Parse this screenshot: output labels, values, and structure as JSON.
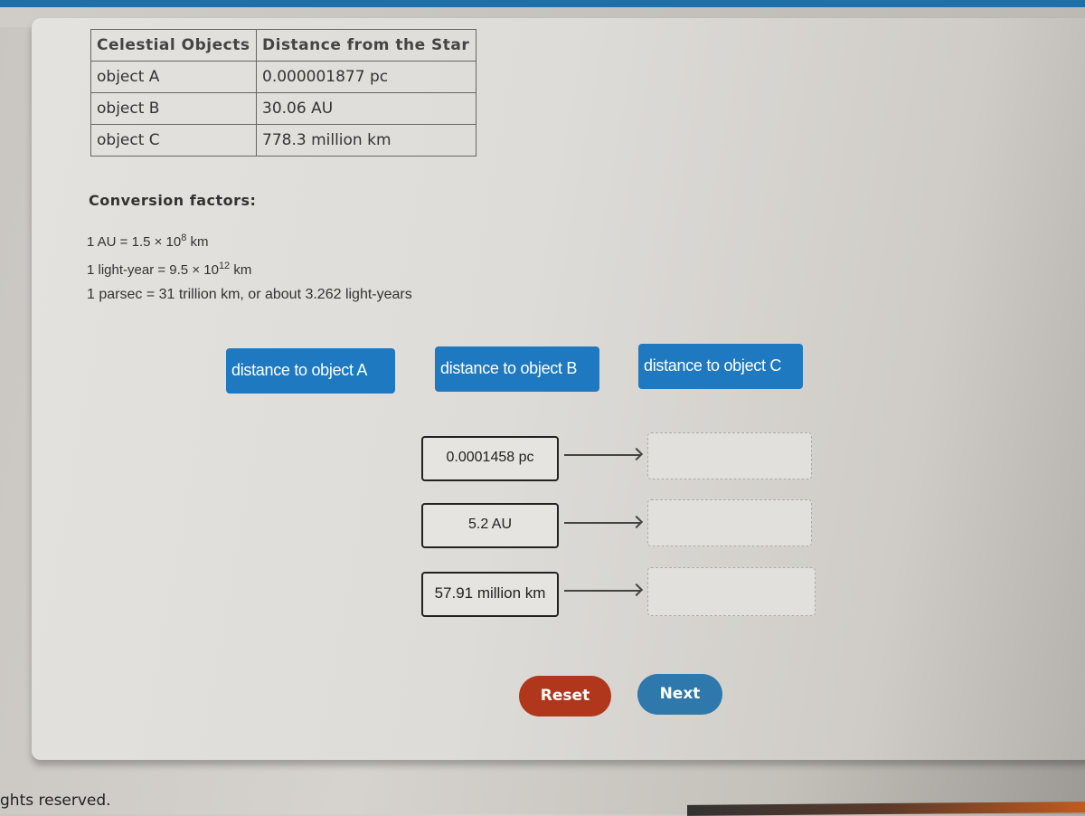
{
  "table": {
    "headers": [
      "Celestial Objects",
      "Distance from the Star"
    ],
    "rows": [
      [
        "object A",
        "0.000001877 pc"
      ],
      [
        "object B",
        "30.06 AU"
      ],
      [
        "object C",
        "778.3 million km"
      ]
    ]
  },
  "conversion": {
    "title": "Conversion factors:",
    "au": {
      "pre": "1 AU = 1.5 × 10",
      "exp": "8",
      "post": " km"
    },
    "ly": {
      "pre": "1 light-year = 9.5 × 10",
      "exp": "12",
      "post": " km"
    },
    "pc": "1 parsec = 31 trillion km, or about 3.262 light-years"
  },
  "targets": [
    "distance to object A",
    "distance to object B",
    "distance to object C"
  ],
  "cards": [
    "0.0001458 pc",
    "5.2 AU",
    "57.91 million km"
  ],
  "actions": {
    "reset": "Reset",
    "next": "Next"
  },
  "footer": "ghts reserved.",
  "colors": {
    "button_blue": "#1f79c0",
    "reset_red": "#b0361c",
    "next_blue": "#2f78ab"
  }
}
